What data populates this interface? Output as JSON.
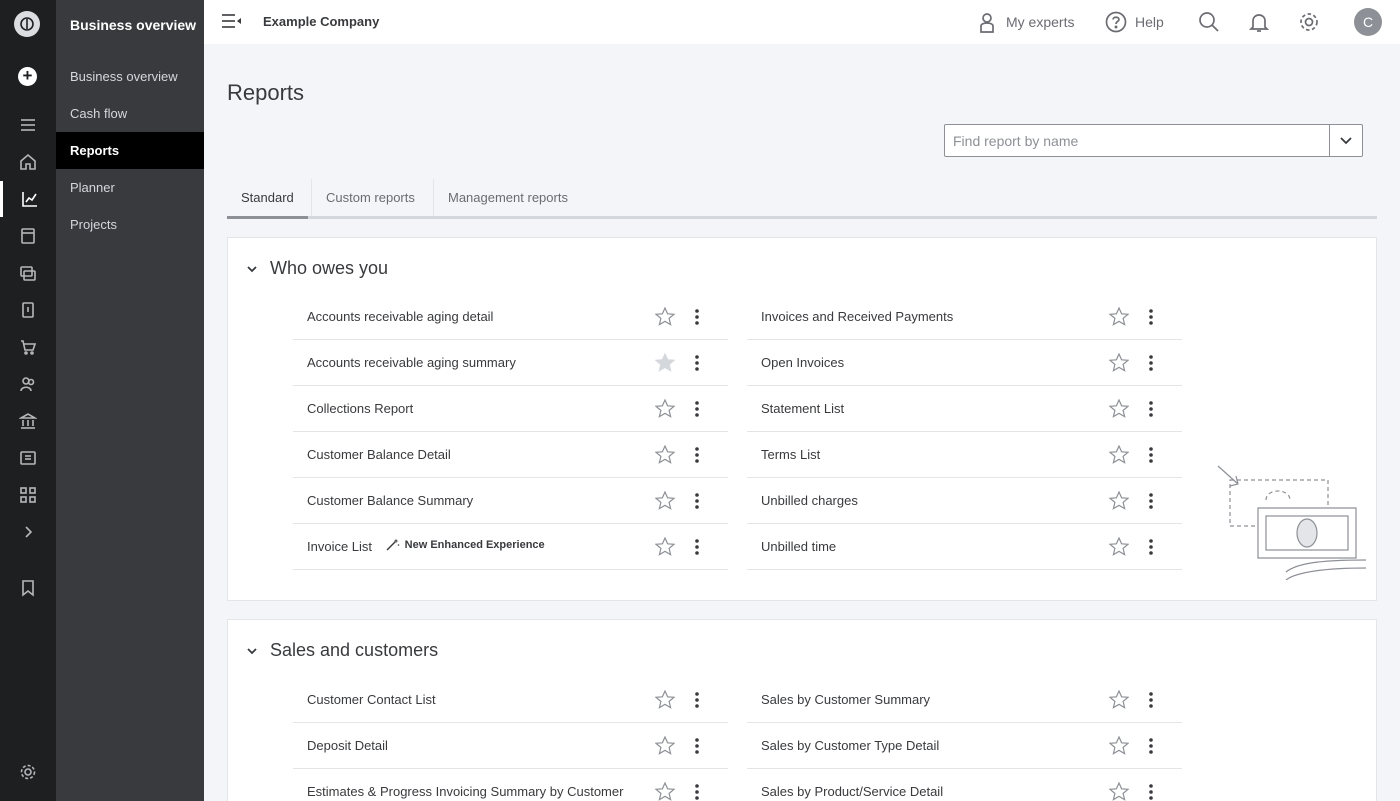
{
  "nav": {
    "title": "Business overview",
    "items": [
      {
        "label": "Business overview"
      },
      {
        "label": "Cash flow"
      },
      {
        "label": "Reports"
      },
      {
        "label": "Planner"
      },
      {
        "label": "Projects"
      }
    ]
  },
  "topbar": {
    "company": "Example Company",
    "experts_label": "My experts",
    "help_label": "Help",
    "avatar_initial": "C"
  },
  "page": {
    "title": "Reports",
    "search_placeholder": "Find report by name"
  },
  "tabs": [
    {
      "label": "Standard"
    },
    {
      "label": "Custom reports"
    },
    {
      "label": "Management reports"
    }
  ],
  "sections": [
    {
      "title": "Who owes you",
      "left": [
        {
          "label": "Accounts receivable aging detail",
          "favorite": false
        },
        {
          "label": "Accounts receivable aging summary",
          "favorite": true
        },
        {
          "label": "Collections Report",
          "favorite": false
        },
        {
          "label": "Customer Balance Detail",
          "favorite": false
        },
        {
          "label": "Customer Balance Summary",
          "favorite": false
        },
        {
          "label": "Invoice List",
          "favorite": false,
          "badge": "New Enhanced Experience"
        }
      ],
      "right": [
        {
          "label": "Invoices and Received Payments",
          "favorite": false
        },
        {
          "label": "Open Invoices",
          "favorite": false
        },
        {
          "label": "Statement List",
          "favorite": false
        },
        {
          "label": "Terms List",
          "favorite": false
        },
        {
          "label": "Unbilled charges",
          "favorite": false
        },
        {
          "label": "Unbilled time",
          "favorite": false
        }
      ]
    },
    {
      "title": "Sales and customers",
      "left": [
        {
          "label": "Customer Contact List",
          "favorite": false
        },
        {
          "label": "Deposit Detail",
          "favorite": false
        },
        {
          "label": "Estimates & Progress Invoicing Summary by Customer",
          "favorite": false
        }
      ],
      "right": [
        {
          "label": "Sales by Customer Summary",
          "favorite": false
        },
        {
          "label": "Sales by Customer Type Detail",
          "favorite": false
        },
        {
          "label": "Sales by Product/Service Detail",
          "favorite": false
        }
      ]
    }
  ],
  "colors": {
    "rail_bg": "#1e1f21",
    "nav_bg": "#393a3d",
    "active_nav": "#000000",
    "page_bg": "#f4f5f8",
    "star_filled": "#d4d7dc"
  }
}
